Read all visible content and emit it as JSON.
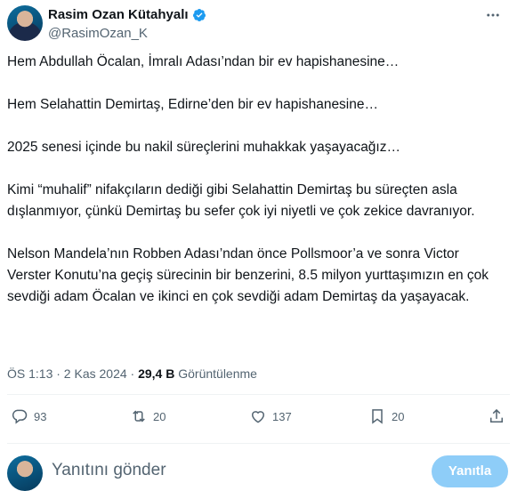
{
  "author": {
    "display_name": "Rasim Ozan Kütahyalı",
    "handle": "@RasimOzan_K"
  },
  "tweet": {
    "paragraphs": [
      "Hem Abdullah Öcalan, İmralı Adası’ndan bir ev hapishanesine…",
      "Hem Selahattin Demirtaş, Edirne’den bir ev hapishanesine…",
      "2025 senesi içinde bu nakil süreçlerini muhakkak yaşayacağız…",
      "Kimi “muhalif” nifakçıların dediği gibi Selahattin Demirtaş bu süreçten asla dışlanmıyor, çünkü Demirtaş bu sefer çok iyi niyetli ve çok zekice davranıyor.",
      "Nelson Mandela’nın Robben Adası’ndan önce Pollsmoor’a ve sonra Victor Verster Konutu’na geçiş sürecinin bir benzerini, 8.5 milyon yurttaşımızın en çok sevdiği adam Öcalan ve ikinci en çok sevdiği adam Demirtaş da yaşayacak."
    ],
    "timestamp": "ÖS 1:13 · 2 Kas 2024 · ",
    "views_count": "29,4 B",
    "views_label": " Görüntülenme"
  },
  "actions": {
    "replies": "93",
    "reposts": "20",
    "likes": "137",
    "bookmarks": "20"
  },
  "reply_box": {
    "placeholder": "Yanıtını gönder",
    "button_label": "Yanıtla"
  },
  "icons": [
    "verified-badge-icon",
    "more-options-icon",
    "reply-icon",
    "repost-icon",
    "like-icon",
    "bookmark-icon",
    "share-icon"
  ],
  "colors": {
    "text_primary": "#0f1419",
    "text_secondary": "#536471",
    "verified_blue": "#1d9bf0",
    "reply_button": "#8ecdf8",
    "divider": "#eff3f4"
  }
}
